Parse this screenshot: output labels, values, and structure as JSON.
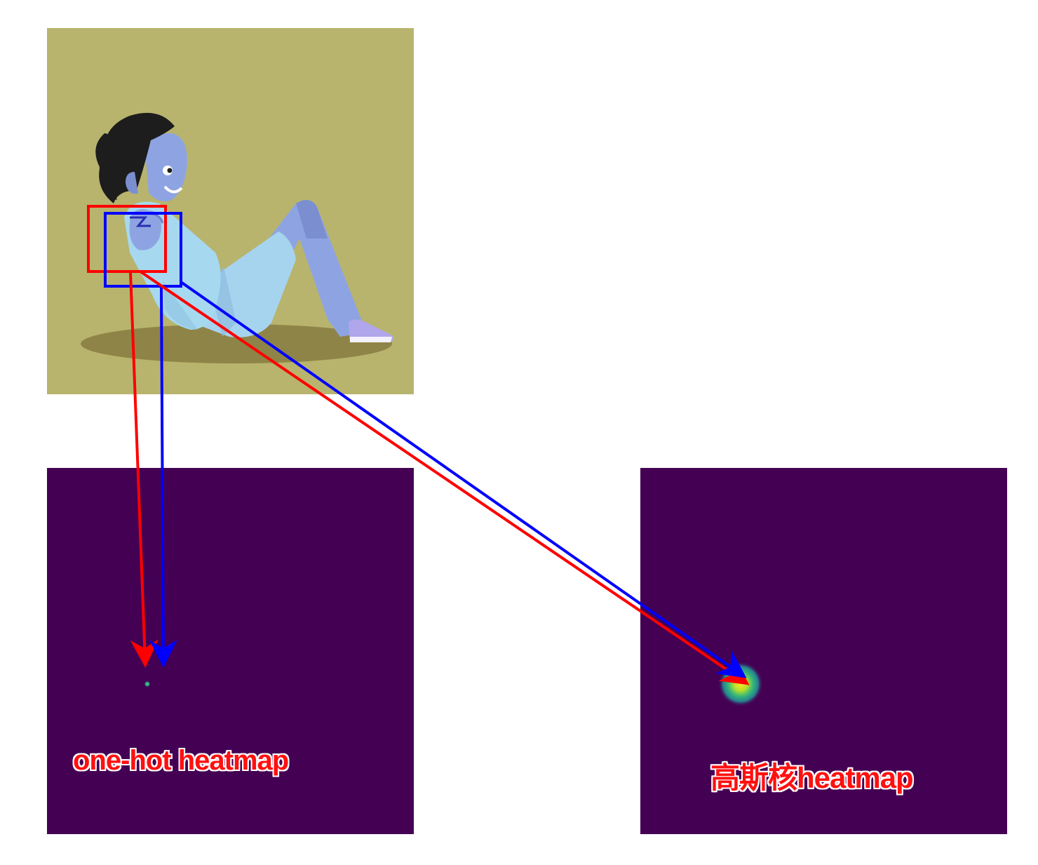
{
  "photo": {
    "subject": "cartoon woman doing sit-ups",
    "background_color": "#b8b46e"
  },
  "boxes": [
    {
      "name": "red",
      "color": "#ff0000"
    },
    {
      "name": "blue",
      "color": "#0000ff"
    }
  ],
  "heatmaps": [
    {
      "name": "one-hot",
      "background_color": "#440154",
      "label": "one-hot heatmap"
    },
    {
      "name": "gaussian",
      "background_color": "#440154",
      "label": "高斯核heatmap"
    }
  ],
  "colors": {
    "label": "#ff1010",
    "arrow_red": "#ff0000",
    "arrow_blue": "#0000ff",
    "peak": "#fde725"
  }
}
